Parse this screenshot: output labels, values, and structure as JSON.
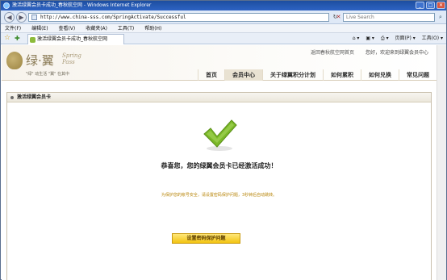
{
  "window": {
    "title": "激活绿翼会员卡成功_春秋航空网 - Windows Internet Explorer",
    "minimize": "_",
    "maximize": "□",
    "close": "✕"
  },
  "browser": {
    "back": "◀",
    "forward": "▶",
    "url": "http://www.china-sss.com/SpringActivate/Successful",
    "refresh": "↻",
    "stop": "✕",
    "search_placeholder": "Live Search",
    "search_icon": "magnifier-icon"
  },
  "menu": {
    "items": [
      "文件(F)",
      "编辑(E)",
      "查看(V)",
      "收藏夹(A)",
      "工具(T)",
      "帮助(H)"
    ]
  },
  "tabs": {
    "favorites_star": "☆",
    "add_fav": "✚",
    "active_tab": "激活绿翼会员卡成功_春秋航空网",
    "tools": [
      "⌂ ▾",
      "▣ ▾",
      "⎙ ▾",
      "页面(P) ▾",
      "工具(O) ▾"
    ]
  },
  "site": {
    "logo_main": "绿·翼",
    "logo_sub": "Spring Pass",
    "slogan": "\"绿\" 动生活 \"翼\" 在其中",
    "top_links": [
      "返回春秋航空网首页",
      "您好，欢迎来到绿翼会员中心"
    ],
    "nav": [
      "首页",
      "会员中心",
      "关于绿翼积分计划",
      "如何累积",
      "如何兑换",
      "常见问题"
    ],
    "nav_active_index": 1
  },
  "panel": {
    "title": "激活绿翼会员卡",
    "success_message": "恭喜您，您的绿翼会员卡已经激活成功！",
    "notice": "为保护您的帐号安全，请设置密码保护问题，3秒钟后自动跳转。",
    "button_label": "设置密码保护问题"
  },
  "colors": {
    "accent_green": "#7bb828",
    "notice_text": "#b8860b",
    "button_yellow": "#f5cc2a"
  }
}
